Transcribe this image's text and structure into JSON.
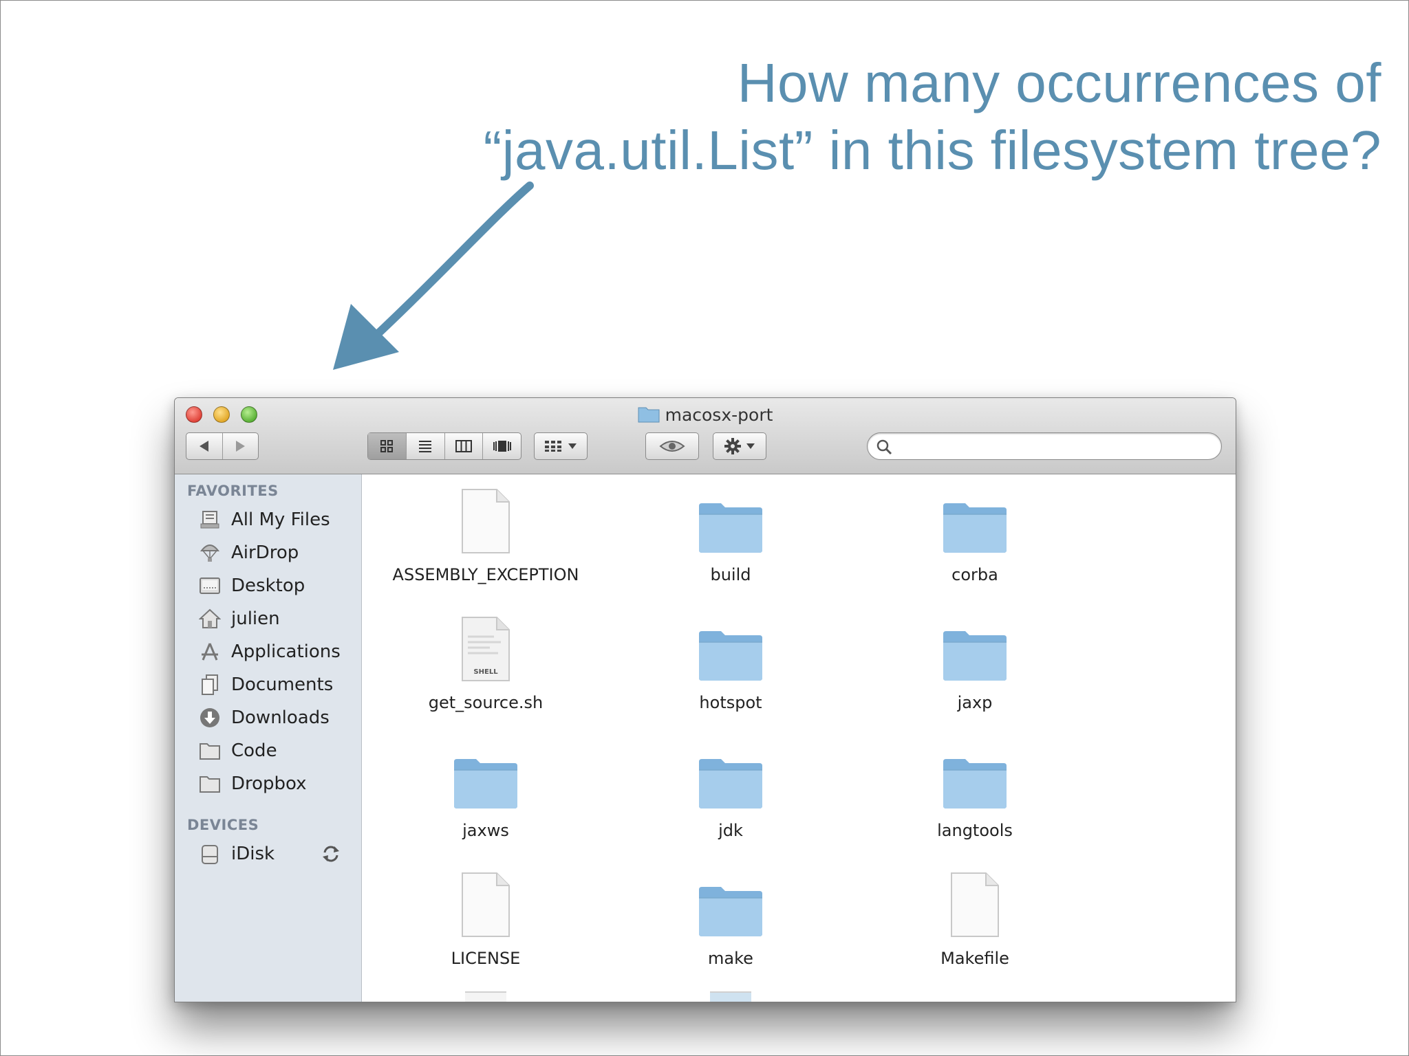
{
  "question": {
    "line1": "How many occurrences of",
    "line2": "“java.util.List” in this filesystem tree?"
  },
  "window": {
    "title": "macosx-port",
    "search": {
      "value": "",
      "placeholder": ""
    }
  },
  "sidebar": {
    "favorites_heading": "FAVORITES",
    "favorites": [
      {
        "label": "All My Files",
        "icon": "all-my-files-icon"
      },
      {
        "label": "AirDrop",
        "icon": "airdrop-icon"
      },
      {
        "label": "Desktop",
        "icon": "desktop-icon"
      },
      {
        "label": "julien",
        "icon": "home-icon"
      },
      {
        "label": "Applications",
        "icon": "applications-icon"
      },
      {
        "label": "Documents",
        "icon": "documents-icon"
      },
      {
        "label": "Downloads",
        "icon": "downloads-icon"
      },
      {
        "label": "Code",
        "icon": "folder-icon"
      },
      {
        "label": "Dropbox",
        "icon": "folder-icon"
      }
    ],
    "devices_heading": "DEVICES",
    "devices": [
      {
        "label": "iDisk",
        "icon": "idisk-icon"
      }
    ]
  },
  "files": [
    {
      "name": "ASSEMBLY_EXCEPTION",
      "kind": "document"
    },
    {
      "name": "build",
      "kind": "folder"
    },
    {
      "name": "corba",
      "kind": "folder"
    },
    {
      "name": "get_source.sh",
      "kind": "shell-script"
    },
    {
      "name": "hotspot",
      "kind": "folder"
    },
    {
      "name": "jaxp",
      "kind": "folder"
    },
    {
      "name": "jaxws",
      "kind": "folder"
    },
    {
      "name": "jdk",
      "kind": "folder"
    },
    {
      "name": "langtools",
      "kind": "folder"
    },
    {
      "name": "LICENSE",
      "kind": "document"
    },
    {
      "name": "make",
      "kind": "folder"
    },
    {
      "name": "Makefile",
      "kind": "document"
    }
  ],
  "shell_badge": "SHELL",
  "colors": {
    "accent": "#5a8fb0",
    "folder": "#8fbfe3",
    "sidebar": "#dfe5ec"
  }
}
